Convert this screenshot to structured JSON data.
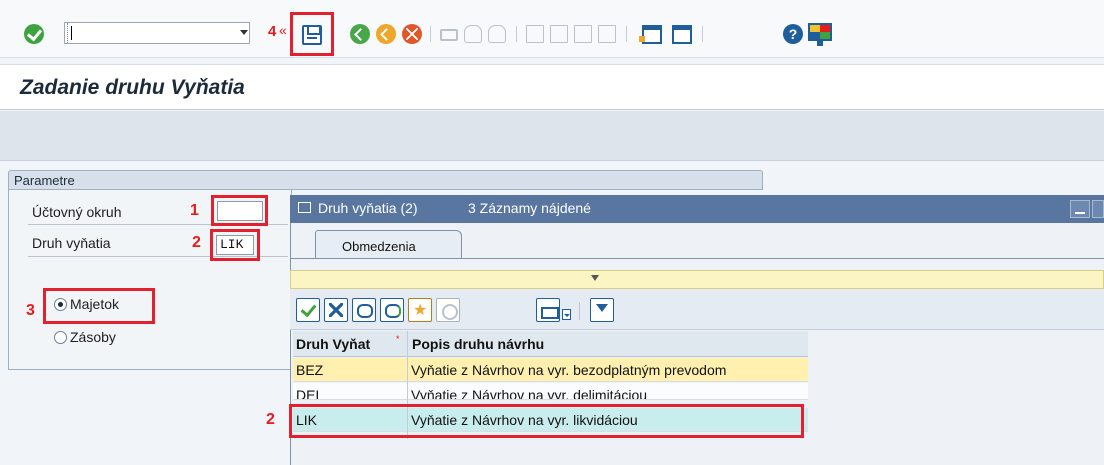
{
  "toolbar": {
    "command_value": "",
    "marker_label": "4",
    "marker_arrow": "«"
  },
  "header": {
    "title": "Zadanie druhu Vyňatia"
  },
  "parameters": {
    "group_label": "Parametre",
    "fields": [
      {
        "label": "Účtovný okruh",
        "value": "",
        "marker": "1"
      },
      {
        "label": "Druh vyňatia",
        "value": "LIK",
        "marker": "2"
      }
    ],
    "radio_marker": "3",
    "radios": [
      {
        "label": "Majetok",
        "selected": true
      },
      {
        "label": "Zásoby",
        "selected": false
      }
    ]
  },
  "popup": {
    "title": "Druh vyňatia (2)",
    "count_text": "3 Záznamy nájdené",
    "tab_label": "Obmedzenia",
    "columns": [
      "Druh Vyňat",
      "Popis druhu návrhu"
    ],
    "sort_mark": "*",
    "rows": [
      {
        "code": "BEZ",
        "description": "Vyňatie z Návrhov na vyr. bezodplatným prevodom"
      },
      {
        "code": "DEL",
        "description": "Vyňatie z Návrhov na vyr. delimitáciou"
      },
      {
        "code": "LIK",
        "description": "Vyňatie z Návrhov na vyr. likvidáciou"
      }
    ],
    "selected_row_marker": "2"
  },
  "colors": {
    "accent": "#5876a0",
    "highlight_row": "#fff0b0",
    "selected_row": "#c9ecec",
    "annotation_red": "#e3212e"
  }
}
